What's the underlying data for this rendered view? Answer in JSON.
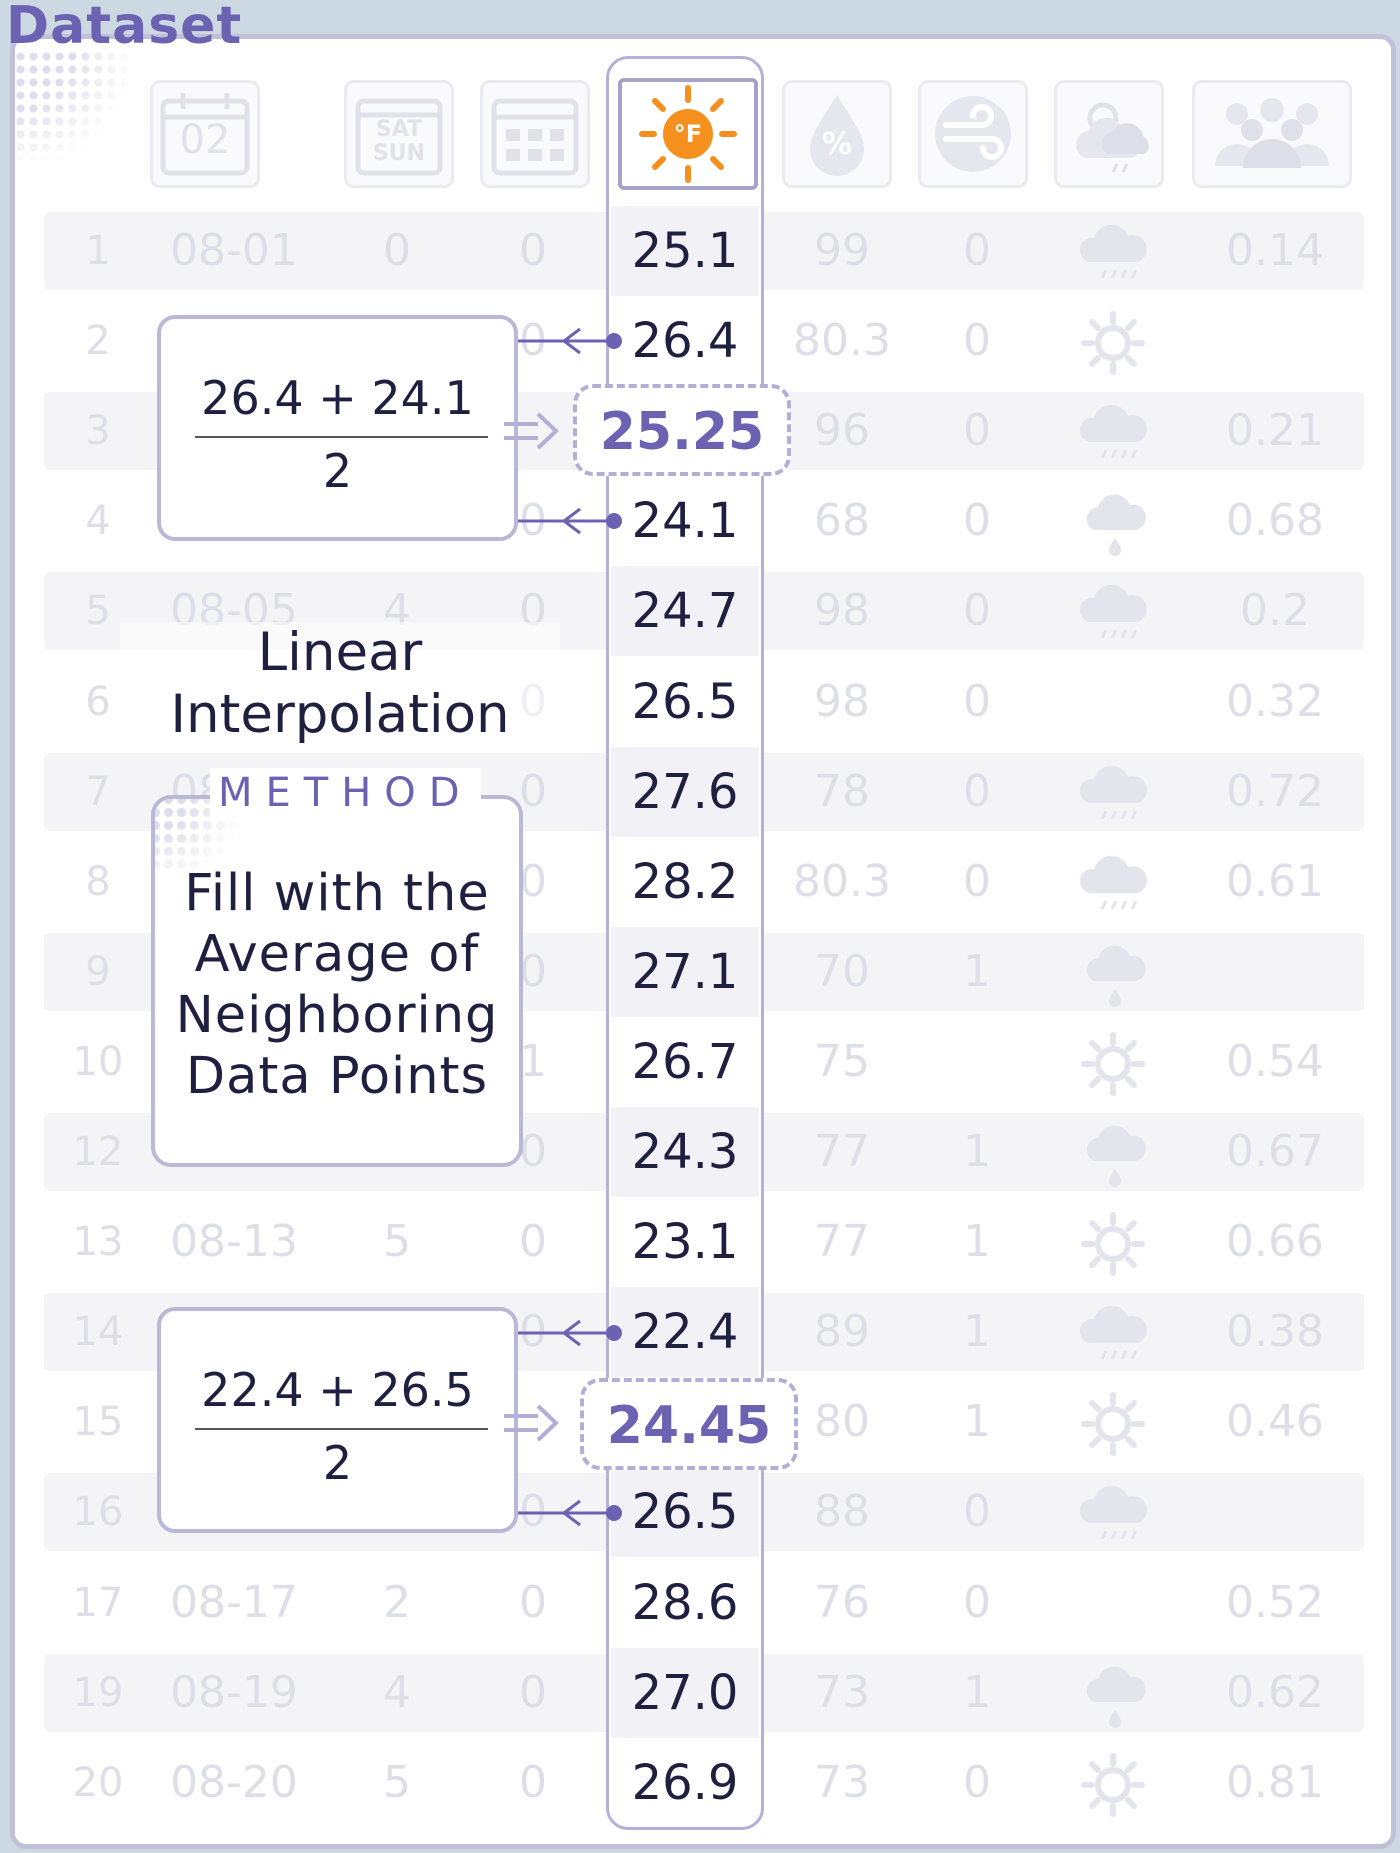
{
  "title": "Dataset",
  "header_icons": [
    {
      "name": "calendar-date-icon",
      "label": "02"
    },
    {
      "name": "weekend-calendar-icon",
      "label_top": "SAT",
      "label_bottom": "SUN"
    },
    {
      "name": "calendar-grid-icon",
      "label": ""
    },
    {
      "name": "temperature-sun-icon",
      "label": "°F"
    },
    {
      "name": "humidity-drop-icon",
      "label": "%"
    },
    {
      "name": "wind-icon",
      "label": ""
    },
    {
      "name": "weather-condition-icon",
      "label": ""
    },
    {
      "name": "crowd-icon",
      "label": ""
    }
  ],
  "rows": [
    {
      "index": "1",
      "date": "08-01",
      "a": "0",
      "b": "0",
      "temp": "25.1",
      "humidity": "99",
      "wind": "0",
      "weather": "rain",
      "value": "0.14"
    },
    {
      "index": "2",
      "date": "",
      "a": "",
      "b": "0",
      "temp": "26.4",
      "humidity": "80.3",
      "wind": "0",
      "weather": "sun",
      "value": ""
    },
    {
      "index": "3",
      "date": "",
      "a": "",
      "b": "",
      "temp": "",
      "humidity": "96",
      "wind": "0",
      "weather": "rain",
      "value": "0.21"
    },
    {
      "index": "4",
      "date": "",
      "a": "",
      "b": "0",
      "temp": "24.1",
      "humidity": "68",
      "wind": "0",
      "weather": "drizzle",
      "value": "0.68"
    },
    {
      "index": "5",
      "date": "08-05",
      "a": "4",
      "b": "0",
      "temp": "24.7",
      "humidity": "98",
      "wind": "0",
      "weather": "rain",
      "value": "0.2"
    },
    {
      "index": "6",
      "date": "",
      "a": "",
      "b": "0",
      "temp": "26.5",
      "humidity": "98",
      "wind": "0",
      "weather": "",
      "value": "0.32"
    },
    {
      "index": "7",
      "date": "08-07",
      "a": "",
      "b": "0",
      "temp": "27.6",
      "humidity": "78",
      "wind": "0",
      "weather": "rain",
      "value": "0.72"
    },
    {
      "index": "8",
      "date": "",
      "a": "",
      "b": "0",
      "temp": "28.2",
      "humidity": "80.3",
      "wind": "0",
      "weather": "rain",
      "value": "0.61"
    },
    {
      "index": "9",
      "date": "",
      "a": "",
      "b": "0",
      "temp": "27.1",
      "humidity": "70",
      "wind": "1",
      "weather": "drizzle",
      "value": ""
    },
    {
      "index": "10",
      "date": "",
      "a": "",
      "b": "1",
      "temp": "26.7",
      "humidity": "75",
      "wind": "",
      "weather": "sun",
      "value": "0.54"
    },
    {
      "index": "12",
      "date": "",
      "a": "",
      "b": "0",
      "temp": "24.3",
      "humidity": "77",
      "wind": "1",
      "weather": "drizzle",
      "value": "0.67"
    },
    {
      "index": "13",
      "date": "08-13",
      "a": "5",
      "b": "0",
      "temp": "23.1",
      "humidity": "77",
      "wind": "1",
      "weather": "sun",
      "value": "0.66"
    },
    {
      "index": "14",
      "date": "",
      "a": "",
      "b": "0",
      "temp": "22.4",
      "humidity": "89",
      "wind": "1",
      "weather": "rain",
      "value": "0.38"
    },
    {
      "index": "15",
      "date": "",
      "a": "",
      "b": "",
      "temp": "",
      "humidity": "80",
      "wind": "1",
      "weather": "sun",
      "value": "0.46"
    },
    {
      "index": "16",
      "date": "",
      "a": "",
      "b": "0",
      "temp": "26.5",
      "humidity": "88",
      "wind": "0",
      "weather": "rain",
      "value": ""
    },
    {
      "index": "17",
      "date": "08-17",
      "a": "2",
      "b": "0",
      "temp": "28.6",
      "humidity": "76",
      "wind": "0",
      "weather": "",
      "value": "0.52"
    },
    {
      "index": "19",
      "date": "08-19",
      "a": "4",
      "b": "0",
      "temp": "27.0",
      "humidity": "73",
      "wind": "1",
      "weather": "drizzle",
      "value": "0.62"
    },
    {
      "index": "20",
      "date": "08-20",
      "a": "5",
      "b": "0",
      "temp": "26.9",
      "humidity": "73",
      "wind": "0",
      "weather": "sun",
      "value": "0.81"
    }
  ],
  "interpolations": [
    {
      "numerator": "26.4 + 24.1",
      "denominator": "2",
      "result": "25.25"
    },
    {
      "numerator": "22.4 + 26.5",
      "denominator": "2",
      "result": "24.45"
    }
  ],
  "explanation": {
    "title_line1": "Linear",
    "title_line2": "Interpolation",
    "method_label": "METHOD",
    "method_line1": "Fill with the",
    "method_line2": "Average of",
    "method_line3": "Neighboring",
    "method_line4": "Data Points"
  },
  "colors": {
    "accent": "#6b62b2",
    "sun": "#f5901e",
    "column_border": "#b3b1d6",
    "faded_text": "#dedee7"
  }
}
